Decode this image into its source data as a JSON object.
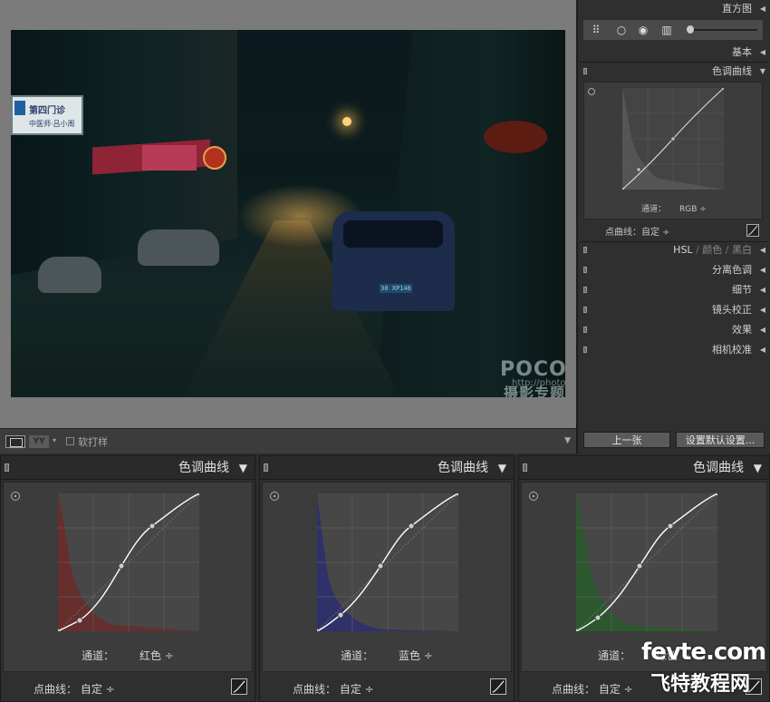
{
  "right_panel": {
    "histogram_label": "直方图",
    "basic_label": "基本",
    "tone_curve_label": "色调曲线",
    "tone_curve": {
      "channel_label": "通道：",
      "channel_value": "RGB ÷",
      "point_curve_label": "点曲线：",
      "point_curve_value": "自定 ÷"
    },
    "hsl_tabs": [
      "HSL",
      "/",
      "颜色",
      "/",
      "黑白"
    ],
    "sections": [
      "分离色调",
      "细节",
      "镜头校正",
      "效果",
      "相机校准"
    ],
    "prev_button": "上一张",
    "defaults_button": "设置默认设置..."
  },
  "toolbar": {
    "yy_label": "YY",
    "soft_proof_label": "软打样"
  },
  "photo": {
    "sign_main": "第四门诊",
    "sign_sub": "中医师·吕小周",
    "plate": "38 XP146",
    "watermark": "POCO",
    "watermark_cn": "摄影专题",
    "watermark_url": "http://photo.poco.cn/"
  },
  "curve_panels": [
    {
      "title": "色调曲线",
      "channel_label": "通道：",
      "channel_value": "红色 ÷",
      "point_curve_label": "点曲线：",
      "point_curve_value": "自定 ÷",
      "histogram_color": "#7a2a2a"
    },
    {
      "title": "色调曲线",
      "channel_label": "通道：",
      "channel_value": "蓝色 ÷",
      "point_curve_label": "点曲线：",
      "point_curve_value": "自定 ÷",
      "histogram_color": "#2c2e6e"
    },
    {
      "title": "色调曲线",
      "channel_label": "通道：",
      "channel_value": "绿色 ÷",
      "point_curve_label": "点曲线：",
      "point_curve_value": "自定 ÷",
      "histogram_color": "#245a2a"
    }
  ],
  "site_watermark": {
    "logo": "fevte.com",
    "logo_cn": "飞特教程网"
  },
  "colors": {
    "panel_bg": "#2f2f2f",
    "curve_bg": "#3c3c3c",
    "curve_line": "#ffffff"
  }
}
